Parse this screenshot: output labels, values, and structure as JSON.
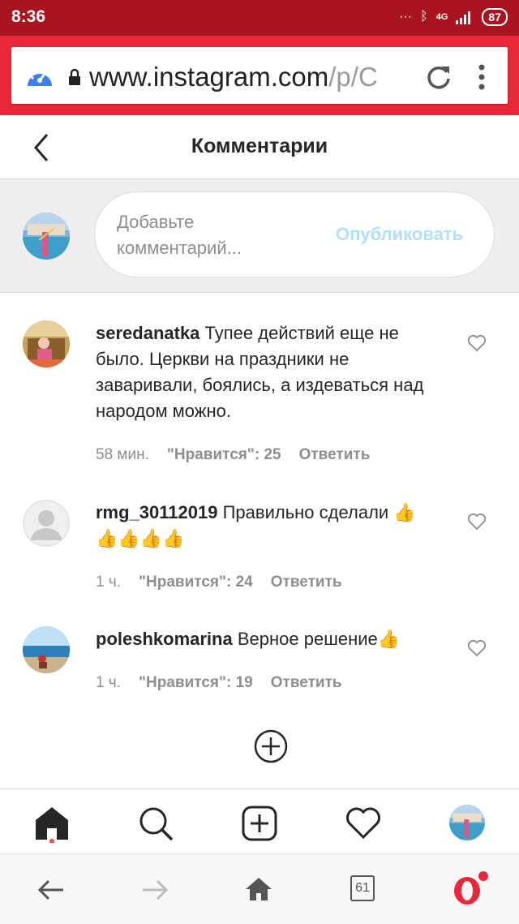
{
  "status": {
    "time": "8:36",
    "network": "4G",
    "battery": "87"
  },
  "browser": {
    "url_host": "www.instagram.com",
    "url_path": "/p/C",
    "tabs_count": "61"
  },
  "header": {
    "title": "Комментарии"
  },
  "composer": {
    "placeholder": "Добавьте комментарий...",
    "publish_label": "Опубликовать"
  },
  "comments": [
    {
      "username": "seredanatka",
      "text": "Тупее действий еще не было. Церкви на праздники не заваривали, боялись, а издеваться над народом можно.",
      "time": "58 мин.",
      "likes": "\"Нравится\": 25",
      "reply": "Ответить"
    },
    {
      "username": "rmg_30112019",
      "text": "Правильно сделали 👍👍👍👍👍",
      "time": "1 ч.",
      "likes": "\"Нравится\": 24",
      "reply": "Ответить"
    },
    {
      "username": "poleshkomarina",
      "text": "Верное решение👍",
      "time": "1 ч.",
      "likes": "\"Нравится\": 19",
      "reply": "Ответить"
    }
  ],
  "icons": {
    "back": "chevron-left-icon",
    "load_more": "plus-circle-icon",
    "nav": [
      "home-icon",
      "search-icon",
      "new-post-icon",
      "heart-icon",
      "profile-avatar"
    ],
    "browser_nav": [
      "arrow-left-icon",
      "arrow-right-icon",
      "home-icon",
      "tabs-icon",
      "opera-icon"
    ]
  },
  "colors": {
    "status_bar": "#a8151f",
    "url_bar": "#e8283a",
    "publish": "#b2dffc",
    "opera_red": "#e8283a"
  }
}
